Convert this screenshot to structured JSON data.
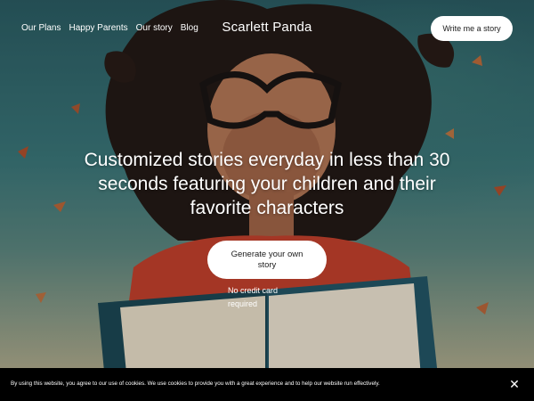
{
  "nav": {
    "links": [
      "Our Plans",
      "Happy Parents",
      "Our story",
      "Blog"
    ],
    "brand": "Scarlett Panda",
    "cta": "Write me a story"
  },
  "hero": {
    "headline": "Customized stories everyday in less than 30 seconds featuring your children and their favorite characters",
    "cta": "Generate your own story",
    "note": "No credit card required",
    "image_icon": "girl-reading-book-illustration"
  },
  "cookie": {
    "text": "By using this website, you agree to our use of cookies. We use cookies to provide you with a great experience and to help our website run effectively.",
    "close_icon": "close-icon"
  },
  "colors": {
    "cookie_bg": "#000000",
    "button_bg": "#ffffff",
    "text": "#ffffff",
    "teal": "#2f6b72",
    "red_shirt": "#c9432e"
  }
}
